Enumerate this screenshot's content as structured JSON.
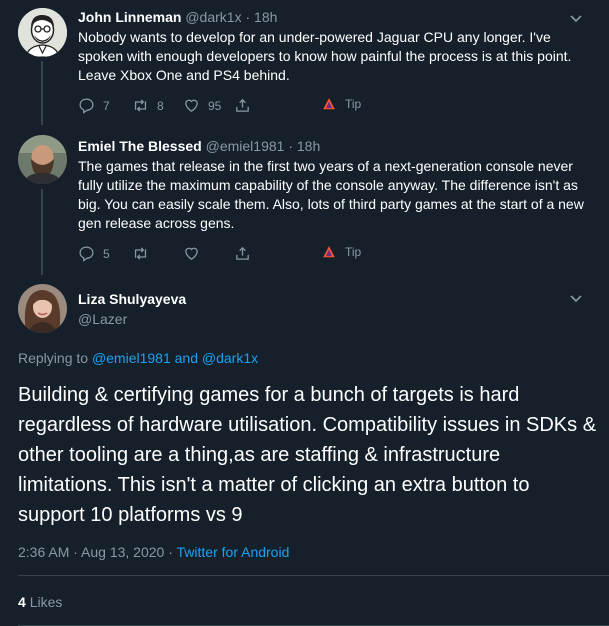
{
  "tweets": [
    {
      "name": "John Linneman",
      "handle": "@dark1x",
      "time": "18h",
      "text": "Nobody wants to develop for an under-powered Jaguar CPU any longer. I've spoken with enough developers to know how painful the process is at this point. Leave Xbox One and PS4 behind.",
      "replies": "7",
      "retweets": "8",
      "likes": "95",
      "tip_label": "Tip"
    },
    {
      "name": "Emiel The Blessed",
      "handle": "@emiel1981",
      "time": "18h",
      "text": "The games that release in the first two years of a next-generation console never fully utilize the maximum capability of the console anyway. The difference isn't as big. You can easily scale them. Also, lots of third party games at the start of a new gen release across gens.",
      "replies": "5",
      "retweets": "",
      "likes": "",
      "tip_label": "Tip"
    }
  ],
  "focus": {
    "name": "Liza Shulyayeva",
    "handle": "@Lazer",
    "replying_prefix": "Replying to",
    "replying_user1": "@emiel1981",
    "replying_and": "and",
    "replying_user2": "@dark1x",
    "text": "Building & certifying games for a bunch of targets is hard regardless of hardware utilisation. Compatibility issues in SDKs & other tooling are a thing,as are staffing & infrastructure limitations. This isn't a matter of clicking an extra button to support 10 platforms vs 9",
    "timestamp": "2:36 AM · Aug 13, 2020 ·",
    "source": "Twitter for Android",
    "likes_count": "4",
    "likes_label": "Likes"
  },
  "colors": {
    "background": "#15202b",
    "secondary_text": "#8899a6",
    "link": "#1da1f2",
    "divider": "#38444d"
  }
}
